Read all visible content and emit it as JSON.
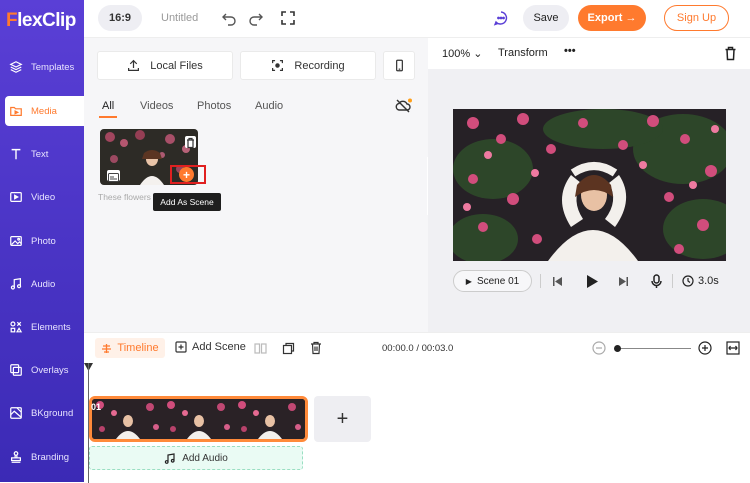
{
  "brand": {
    "logo_f": "F",
    "logo_rest": "lexClip"
  },
  "sidebar": {
    "items": [
      {
        "label": "Templates"
      },
      {
        "label": "Media"
      },
      {
        "label": "Text"
      },
      {
        "label": "Video"
      },
      {
        "label": "Photo"
      },
      {
        "label": "Audio"
      },
      {
        "label": "Elements"
      },
      {
        "label": "Overlays"
      },
      {
        "label": "BKground"
      },
      {
        "label": "Branding"
      }
    ],
    "active": "Media"
  },
  "topbar": {
    "ratio": "16:9",
    "title": "Untitled",
    "save": "Save",
    "export": "Export →",
    "signup": "Sign Up"
  },
  "media": {
    "local_files": "Local Files",
    "recording": "Recording",
    "tabs": [
      {
        "label": "All"
      },
      {
        "label": "Videos"
      },
      {
        "label": "Photos"
      },
      {
        "label": "Audio"
      }
    ],
    "active_tab": "All",
    "item_caption": "These flowers",
    "tooltip": "Add As Scene"
  },
  "preview": {
    "zoom": "100%",
    "transform": "Transform",
    "more": "•••",
    "scene": "Scene 01",
    "duration": "3.0s"
  },
  "timeline": {
    "tab": "Timeline",
    "add_scene": "Add Scene",
    "time": "00:00.0 / 00:03.0",
    "clip_number": "01",
    "add_clip": "+",
    "add_audio": "Add Audio",
    "zoom_level": 0.0
  },
  "colors": {
    "accent": "#ff7a2e",
    "sidebar": "#4a33c8",
    "audio_track": "#eafbf4"
  }
}
